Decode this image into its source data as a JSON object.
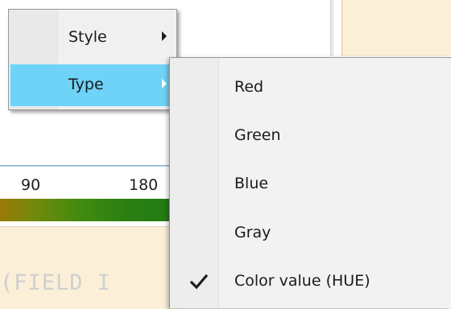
{
  "background": {
    "scale_labels": [
      "90",
      "180"
    ],
    "code_text": "(FIELD I"
  },
  "context_menu": {
    "items": [
      {
        "label": "Style",
        "has_submenu": true,
        "highlighted": false
      },
      {
        "label": "Type",
        "has_submenu": true,
        "highlighted": true
      }
    ],
    "highlight_color": "#6fd3f7"
  },
  "type_submenu": {
    "items": [
      {
        "label": "Red",
        "checked": false
      },
      {
        "label": "Green",
        "checked": false
      },
      {
        "label": "Blue",
        "checked": false
      },
      {
        "label": "Gray",
        "checked": false
      },
      {
        "label": "Color value (HUE)",
        "checked": true
      }
    ],
    "check_icon": "checkmark-icon"
  }
}
